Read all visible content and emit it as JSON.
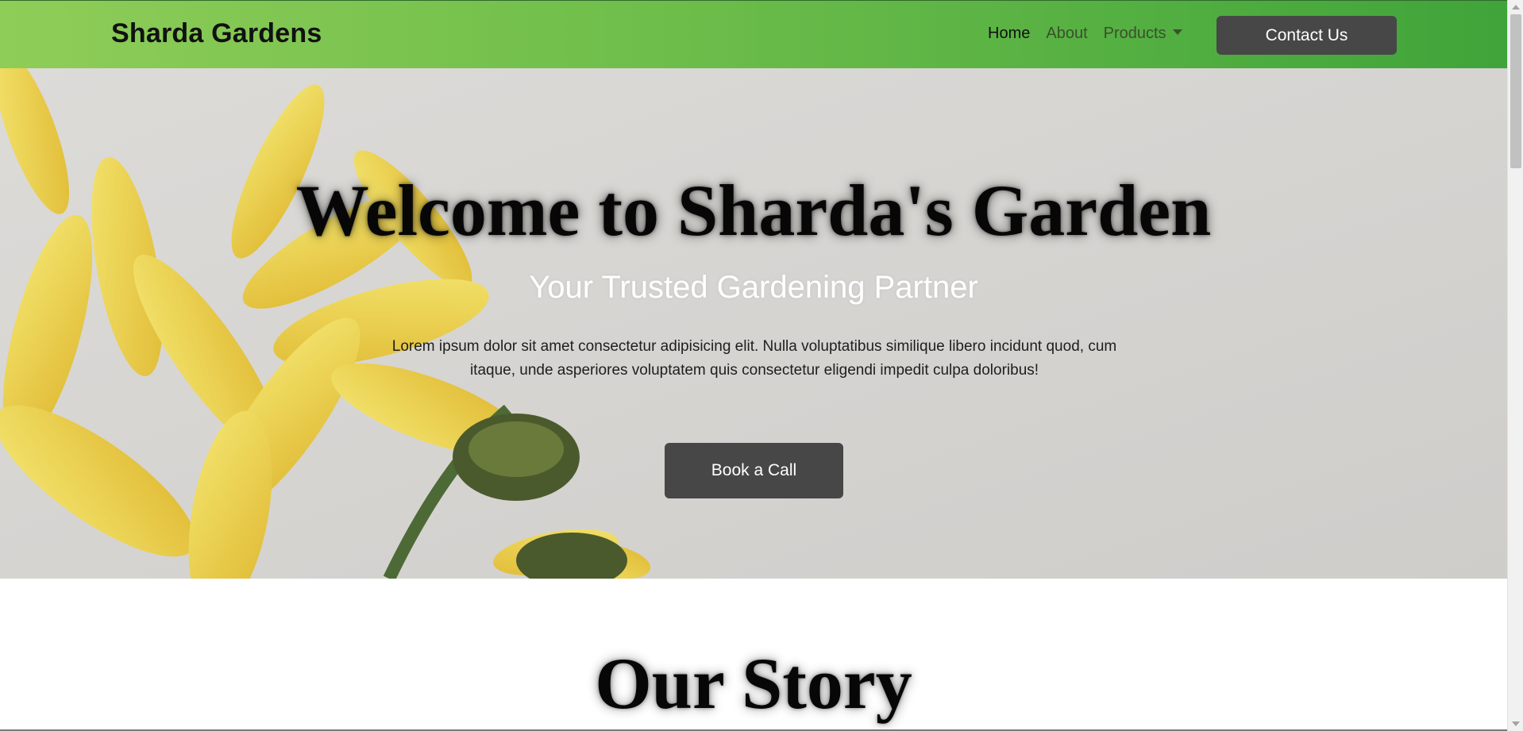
{
  "navbar": {
    "brand": "Sharda Gardens",
    "links": [
      {
        "label": "Home"
      },
      {
        "label": "About"
      },
      {
        "label": "Products"
      }
    ],
    "contact_label": "Contact Us"
  },
  "hero": {
    "title": "Welcome to Sharda's Garden",
    "subtitle": "Your Trusted Gardening Partner",
    "text": "Lorem ipsum dolor sit amet consectetur adipisicing elit. Nulla voluptatibus similique libero incidunt quod, cum itaque, unde asperiores voluptatem quis consectetur eligendi impedit culpa doloribus!",
    "cta_label": "Book a Call"
  },
  "story": {
    "title": "Our Story"
  },
  "icons": {
    "dropdown": "caret-down-icon"
  },
  "colors": {
    "nav_gradient_start": "#8fcd58",
    "nav_gradient_end": "#3fa43a",
    "button_bg": "#474747",
    "hero_bg": "#d6d5d2",
    "petal": "#f1d640"
  }
}
